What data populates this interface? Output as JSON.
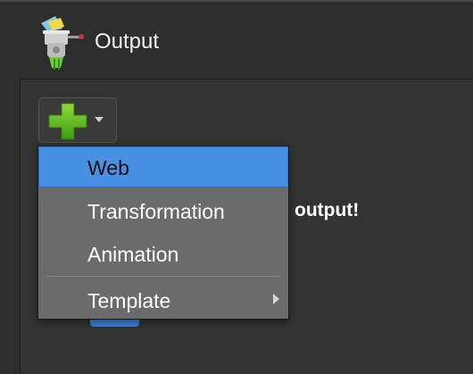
{
  "header": {
    "title": "Output",
    "logo_icon": "meat-grinder-logo-icon"
  },
  "toolbar": {
    "add_icon": "green-plus-icon",
    "dropdown_icon": "chevron-down-icon"
  },
  "background": {
    "partial_text": "output!"
  },
  "menu": {
    "items": [
      {
        "label": "Web",
        "selected": true
      },
      {
        "label": "Transformation",
        "selected": false
      },
      {
        "label": "Animation",
        "selected": false
      },
      {
        "label": "Template",
        "selected": false,
        "has_submenu": true
      }
    ]
  },
  "colors": {
    "selection": "#4a90e2",
    "menu_bg": "#6b6b6b",
    "plus_green": "#5ab41e"
  }
}
